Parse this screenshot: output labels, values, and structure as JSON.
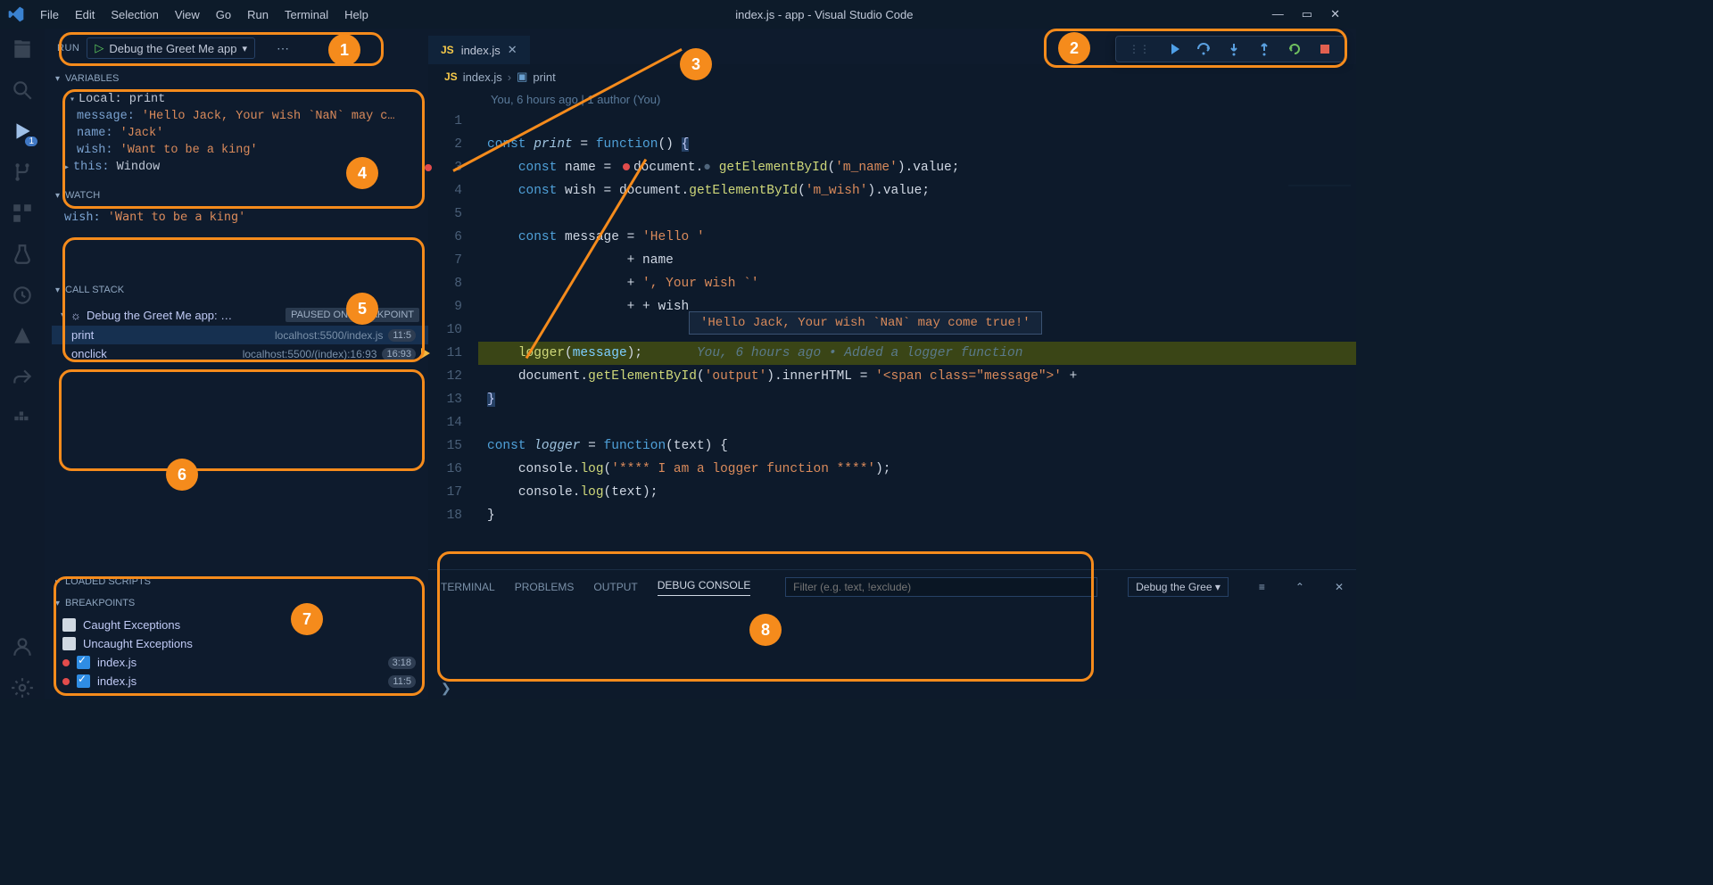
{
  "window_title": "index.js - app - Visual Studio Code",
  "menu": [
    "File",
    "Edit",
    "Selection",
    "View",
    "Go",
    "Run",
    "Terminal",
    "Help"
  ],
  "run_header": {
    "label": "RUN",
    "config": "Debug the Greet Me app"
  },
  "sections": {
    "variables": "VARIABLES",
    "watch": "WATCH",
    "call_stack": "CALL STACK",
    "loaded_scripts": "LOADED SCRIPTS",
    "breakpoints": "BREAKPOINTS"
  },
  "variables_scope": "Local: print",
  "vars": [
    {
      "k": "message:",
      "v": "'Hello Jack, Your wish `NaN` may c…"
    },
    {
      "k": "name:",
      "v": "'Jack'"
    },
    {
      "k": "wish:",
      "v": "'Want to be a king'"
    },
    {
      "k": "this:",
      "v": "Window",
      "obj": true
    }
  ],
  "watch": [
    {
      "k": "wish:",
      "v": "'Want to be a king'"
    }
  ],
  "call_stack": {
    "title": "Debug the Greet Me app: …",
    "status": "PAUSED ON BREAKPOINT",
    "frames": [
      {
        "fn": "print",
        "loc": "localhost:5500/index.js",
        "line": "11:5",
        "sel": true
      },
      {
        "fn": "onclick",
        "loc": "localhost:5500/(index):16:93",
        "line": "16:93"
      }
    ]
  },
  "breakpoints": {
    "caught": "Caught Exceptions",
    "uncaught": "Uncaught Exceptions",
    "items": [
      {
        "file": "index.js",
        "line": "3:18"
      },
      {
        "file": "index.js",
        "line": "11:5"
      }
    ]
  },
  "tab_name": "index.js",
  "breadcrumb": {
    "file": "index.js",
    "symbol": "print"
  },
  "codelens": "You, 6 hours ago | 1 author (You)",
  "code": {
    "l2": "const print = function() {",
    "l3": "    const name =  document.  getElementById('m_name').value;",
    "l4": "    const wish = document.getElementById('m_wish').value;",
    "l6": "    const message = 'Hello '",
    "l7": "                  + name",
    "l8": "                  + ', Your wish `'",
    "l9": "                  + + wish",
    "l11": "    logger(message);",
    "l11_hint": "You, 6 hours ago • Added a logger function",
    "l12": "    document.getElementById('output').innerHTML = '<span class=\"message\">' +",
    "l13": "}",
    "l15": "const logger = function(text) {",
    "l16": "    console.log('**** I am a logger function ****');",
    "l17": "    console.log(text);",
    "l18": "}"
  },
  "hover_value": "'Hello Jack, Your wish `NaN` may come true!'",
  "panel": {
    "tabs": [
      "TERMINAL",
      "PROBLEMS",
      "OUTPUT",
      "DEBUG CONSOLE"
    ],
    "active": 3,
    "filter_ph": "Filter (e.g. text, !exclude)",
    "scope": "Debug the Gree"
  },
  "activity_badge": "1",
  "annotations": [
    "1",
    "2",
    "3",
    "4",
    "5",
    "6",
    "7",
    "8"
  ]
}
